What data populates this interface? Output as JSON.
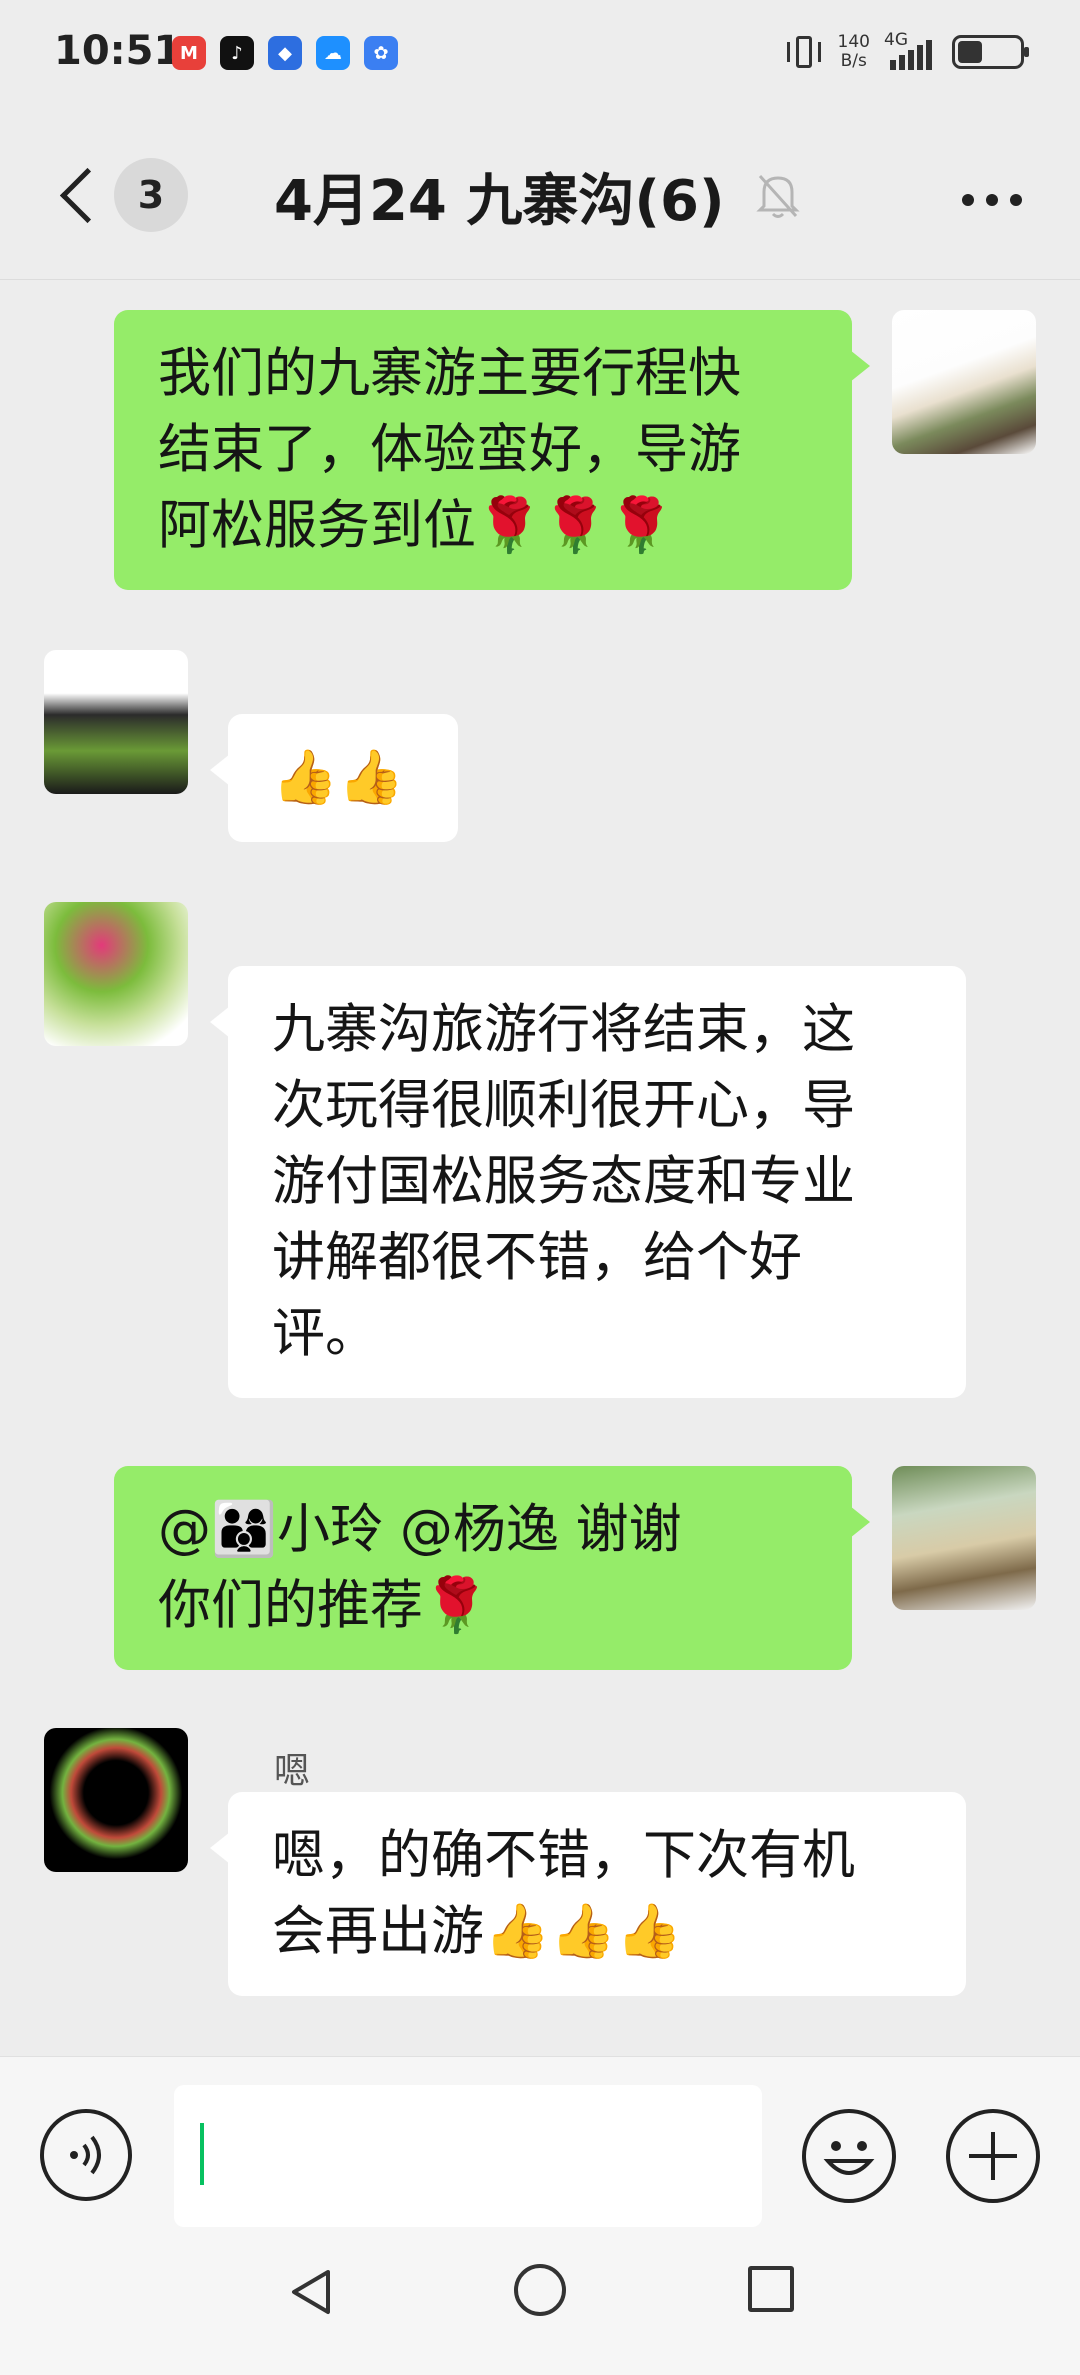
{
  "status_bar": {
    "time": "10:51",
    "net_speed_value": "140",
    "net_speed_unit": "B/s",
    "network": "4G",
    "battery_level_percent": 40,
    "apps": [
      {
        "name": "metro-app-icon",
        "glyph": "M",
        "color": "#e8403a"
      },
      {
        "name": "tiktok-app-icon",
        "glyph": "♪",
        "color": "#111111"
      },
      {
        "name": "bank-app-icon",
        "glyph": "◆",
        "color": "#2d6ee0"
      },
      {
        "name": "weather-app-icon",
        "glyph": "☁",
        "color": "#1e90ff"
      },
      {
        "name": "baidu-app-icon",
        "glyph": "✿",
        "color": "#3b7ff2"
      }
    ]
  },
  "header": {
    "unread_count": "3",
    "title": "4月24 九寨沟(6)"
  },
  "messages": [
    {
      "side": "mine",
      "text_lines": [
        "我们的九寨游主要行程快",
        "结束了，体验蛮好，导游",
        "阿松服务到位🌹🌹🌹"
      ]
    },
    {
      "side": "theirs",
      "sender": "",
      "text_lines": [
        "👍👍"
      ]
    },
    {
      "side": "theirs",
      "sender": "",
      "text_lines": [
        "九寨沟旅游行将结束，这",
        "次玩得很顺利很开心，导",
        "游付国松服务态度和专业",
        "讲解都很不错，给个好",
        "评。"
      ]
    },
    {
      "side": "mine",
      "text_lines": [
        "@👨‍👩‍👦小玲 @杨逸  谢谢",
        "你们的推荐🌹"
      ]
    },
    {
      "side": "theirs",
      "sender": "嗯",
      "text_lines": [
        "嗯，的确不错，下次有机",
        "会再出游👍👍👍"
      ]
    }
  ],
  "input_bar": {
    "value": ""
  },
  "colors": {
    "my_bubble": "#95ec69",
    "their_bubble": "#ffffff",
    "background": "#ededed",
    "caret": "#07c160"
  }
}
